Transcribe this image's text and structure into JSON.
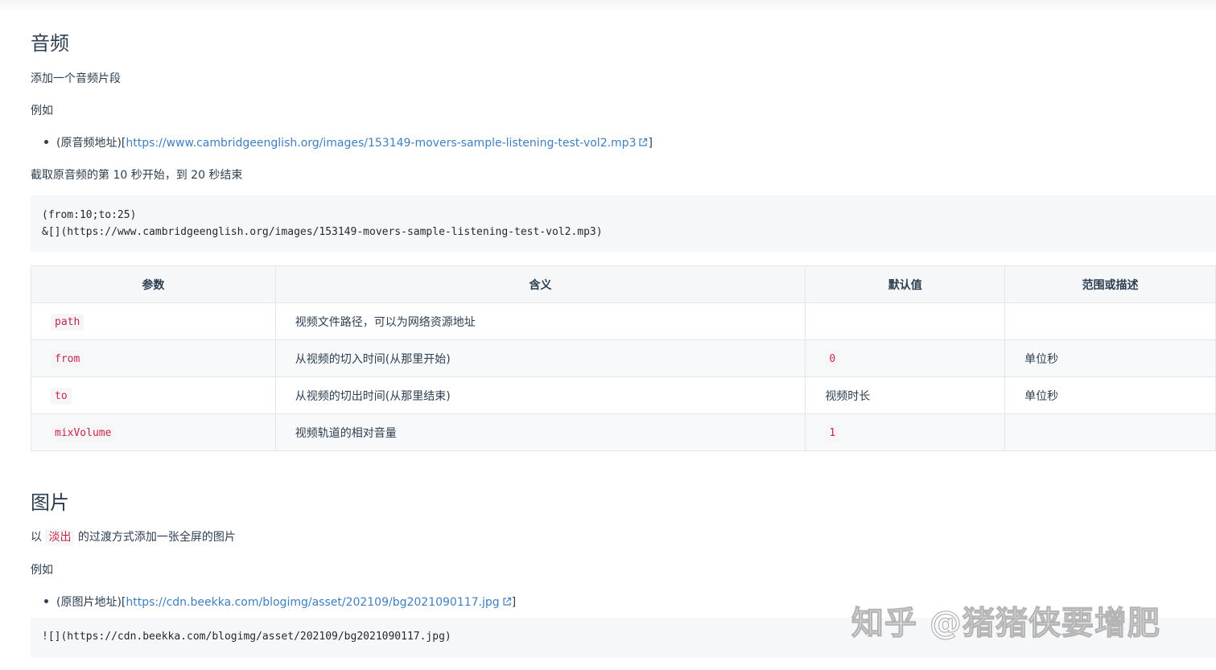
{
  "audio": {
    "heading": "音频",
    "desc": "添加一个音频片段",
    "example_label": "例如",
    "bullet_prefix": "(原音频地址)[",
    "bullet_link": "https://www.cambridgeenglish.org/images/153149-movers-sample-listening-test-vol2.mp3",
    "bullet_suffix": "]",
    "note": "截取原音频的第 10 秒开始，到 20 秒结束",
    "code_line1": "(from:10;to:25)",
    "code_line2": "&[](https://www.cambridgeenglish.org/images/153149-movers-sample-listening-test-vol2.mp3)"
  },
  "table": {
    "headers": [
      "参数",
      "含义",
      "默认值",
      "范围或描述"
    ],
    "rows": [
      {
        "param": "path",
        "meaning": "视频文件路径，可以为网络资源地址",
        "default": "",
        "default_code": false,
        "range": ""
      },
      {
        "param": "from",
        "meaning": "从视频的切入时间(从那里开始)",
        "default": "0",
        "default_code": true,
        "range": "单位秒"
      },
      {
        "param": "to",
        "meaning": "从视频的切出时间(从那里结束)",
        "default": "视频时长",
        "default_code": false,
        "range": "单位秒"
      },
      {
        "param": "mixVolume",
        "meaning": "视频轨道的相对音量",
        "default": "1",
        "default_code": true,
        "range": ""
      }
    ]
  },
  "image": {
    "heading": "图片",
    "desc_prefix": "以",
    "desc_highlight": "淡出",
    "desc_suffix": "的过渡方式添加一张全屏的图片",
    "example_label": "例如",
    "bullet_prefix": "(原图片地址)[",
    "bullet_link": "https://cdn.beekka.com/blogimg/asset/202109/bg2021090117.jpg",
    "bullet_suffix": "]",
    "code_line1": "![](https://cdn.beekka.com/blogimg/asset/202109/bg2021090117.jpg)"
  },
  "watermark": "知乎 @猪猪侠要增肥",
  "colors": {
    "link": "#3e7fc1",
    "code_text": "#c7254e",
    "code_bg": "#f6f7f9",
    "text": "#2c3e50"
  }
}
